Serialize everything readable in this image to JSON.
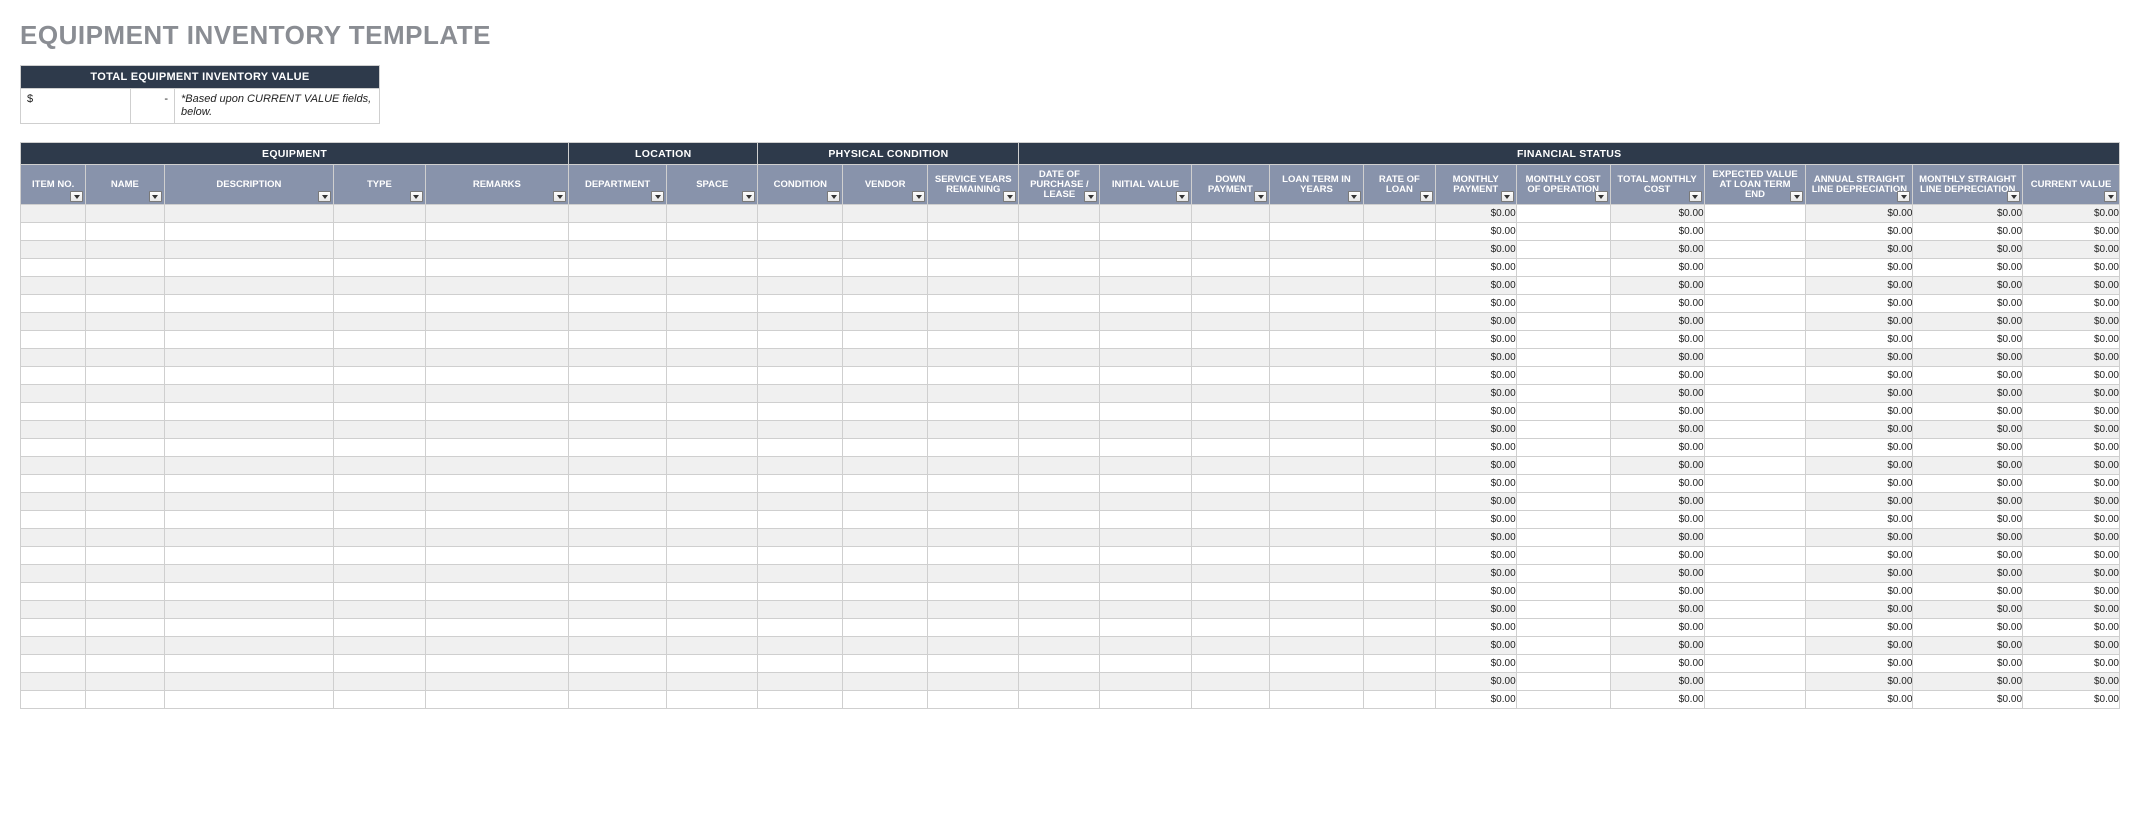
{
  "title": "EQUIPMENT INVENTORY TEMPLATE",
  "summary": {
    "label": "TOTAL EQUIPMENT INVENTORY VALUE",
    "currency": "$",
    "amount": "-",
    "note": "*Based upon CURRENT VALUE fields, below."
  },
  "groupHeaders": [
    "EQUIPMENT",
    "LOCATION",
    "PHYSICAL CONDITION",
    "FINANCIAL STATUS"
  ],
  "groupSpans": [
    5,
    2,
    3,
    12
  ],
  "columns": [
    "ITEM NO.",
    "NAME",
    "DESCRIPTION",
    "TYPE",
    "REMARKS",
    "DEPARTMENT",
    "SPACE",
    "CONDITION",
    "VENDOR",
    "SERVICE YEARS REMAINING",
    "DATE OF PURCHASE / LEASE",
    "INITIAL VALUE",
    "DOWN PAYMENT",
    "LOAN TERM IN YEARS",
    "RATE OF LOAN",
    "MONTHLY PAYMENT",
    "MONTHLY COST OF OPERATION",
    "TOTAL MONTHLY COST",
    "EXPECTED VALUE AT LOAN TERM END",
    "ANNUAL STRAIGHT LINE DEPRECIATION",
    "MONTHLY STRAIGHT LINE DEPRECIATION",
    "CURRENT VALUE"
  ],
  "calcColumnIndices": [
    15,
    17,
    19,
    20,
    21
  ],
  "whiteColumnIndices": [
    16,
    18
  ],
  "rows": [
    {
      "monthly_payment": "$0.00",
      "total_monthly_cost": "$0.00",
      "annual_depr": "$0.00",
      "monthly_depr": "$0.00",
      "current_value": "$0.00"
    },
    {
      "monthly_payment": "$0.00",
      "total_monthly_cost": "$0.00",
      "annual_depr": "$0.00",
      "monthly_depr": "$0.00",
      "current_value": "$0.00"
    },
    {
      "monthly_payment": "$0.00",
      "total_monthly_cost": "$0.00",
      "annual_depr": "$0.00",
      "monthly_depr": "$0.00",
      "current_value": "$0.00"
    },
    {
      "monthly_payment": "$0.00",
      "total_monthly_cost": "$0.00",
      "annual_depr": "$0.00",
      "monthly_depr": "$0.00",
      "current_value": "$0.00"
    },
    {
      "monthly_payment": "$0.00",
      "total_monthly_cost": "$0.00",
      "annual_depr": "$0.00",
      "monthly_depr": "$0.00",
      "current_value": "$0.00"
    },
    {
      "monthly_payment": "$0.00",
      "total_monthly_cost": "$0.00",
      "annual_depr": "$0.00",
      "monthly_depr": "$0.00",
      "current_value": "$0.00"
    },
    {
      "monthly_payment": "$0.00",
      "total_monthly_cost": "$0.00",
      "annual_depr": "$0.00",
      "monthly_depr": "$0.00",
      "current_value": "$0.00"
    },
    {
      "monthly_payment": "$0.00",
      "total_monthly_cost": "$0.00",
      "annual_depr": "$0.00",
      "monthly_depr": "$0.00",
      "current_value": "$0.00"
    },
    {
      "monthly_payment": "$0.00",
      "total_monthly_cost": "$0.00",
      "annual_depr": "$0.00",
      "monthly_depr": "$0.00",
      "current_value": "$0.00"
    },
    {
      "monthly_payment": "$0.00",
      "total_monthly_cost": "$0.00",
      "annual_depr": "$0.00",
      "monthly_depr": "$0.00",
      "current_value": "$0.00"
    },
    {
      "monthly_payment": "$0.00",
      "total_monthly_cost": "$0.00",
      "annual_depr": "$0.00",
      "monthly_depr": "$0.00",
      "current_value": "$0.00"
    },
    {
      "monthly_payment": "$0.00",
      "total_monthly_cost": "$0.00",
      "annual_depr": "$0.00",
      "monthly_depr": "$0.00",
      "current_value": "$0.00"
    },
    {
      "monthly_payment": "$0.00",
      "total_monthly_cost": "$0.00",
      "annual_depr": "$0.00",
      "monthly_depr": "$0.00",
      "current_value": "$0.00"
    },
    {
      "monthly_payment": "$0.00",
      "total_monthly_cost": "$0.00",
      "annual_depr": "$0.00",
      "monthly_depr": "$0.00",
      "current_value": "$0.00"
    },
    {
      "monthly_payment": "$0.00",
      "total_monthly_cost": "$0.00",
      "annual_depr": "$0.00",
      "monthly_depr": "$0.00",
      "current_value": "$0.00"
    },
    {
      "monthly_payment": "$0.00",
      "total_monthly_cost": "$0.00",
      "annual_depr": "$0.00",
      "monthly_depr": "$0.00",
      "current_value": "$0.00"
    },
    {
      "monthly_payment": "$0.00",
      "total_monthly_cost": "$0.00",
      "annual_depr": "$0.00",
      "monthly_depr": "$0.00",
      "current_value": "$0.00"
    },
    {
      "monthly_payment": "$0.00",
      "total_monthly_cost": "$0.00",
      "annual_depr": "$0.00",
      "monthly_depr": "$0.00",
      "current_value": "$0.00"
    },
    {
      "monthly_payment": "$0.00",
      "total_monthly_cost": "$0.00",
      "annual_depr": "$0.00",
      "monthly_depr": "$0.00",
      "current_value": "$0.00"
    },
    {
      "monthly_payment": "$0.00",
      "total_monthly_cost": "$0.00",
      "annual_depr": "$0.00",
      "monthly_depr": "$0.00",
      "current_value": "$0.00"
    },
    {
      "monthly_payment": "$0.00",
      "total_monthly_cost": "$0.00",
      "annual_depr": "$0.00",
      "monthly_depr": "$0.00",
      "current_value": "$0.00"
    },
    {
      "monthly_payment": "$0.00",
      "total_monthly_cost": "$0.00",
      "annual_depr": "$0.00",
      "monthly_depr": "$0.00",
      "current_value": "$0.00"
    },
    {
      "monthly_payment": "$0.00",
      "total_monthly_cost": "$0.00",
      "annual_depr": "$0.00",
      "monthly_depr": "$0.00",
      "current_value": "$0.00"
    },
    {
      "monthly_payment": "$0.00",
      "total_monthly_cost": "$0.00",
      "annual_depr": "$0.00",
      "monthly_depr": "$0.00",
      "current_value": "$0.00"
    },
    {
      "monthly_payment": "$0.00",
      "total_monthly_cost": "$0.00",
      "annual_depr": "$0.00",
      "monthly_depr": "$0.00",
      "current_value": "$0.00"
    },
    {
      "monthly_payment": "$0.00",
      "total_monthly_cost": "$0.00",
      "annual_depr": "$0.00",
      "monthly_depr": "$0.00",
      "current_value": "$0.00"
    },
    {
      "monthly_payment": "$0.00",
      "total_monthly_cost": "$0.00",
      "annual_depr": "$0.00",
      "monthly_depr": "$0.00",
      "current_value": "$0.00"
    },
    {
      "monthly_payment": "$0.00",
      "total_monthly_cost": "$0.00",
      "annual_depr": "$0.00",
      "monthly_depr": "$0.00",
      "current_value": "$0.00"
    }
  ]
}
